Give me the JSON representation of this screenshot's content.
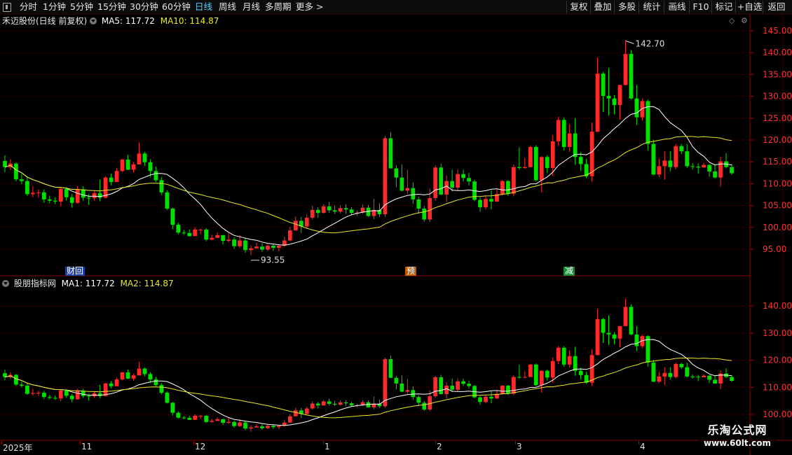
{
  "toolbar": {
    "periods": [
      "分时",
      "1分钟",
      "5分钟",
      "15分钟",
      "30分钟",
      "60分钟",
      "日线",
      "周线",
      "月线",
      "多周期",
      "更多 >"
    ],
    "active_period": "日线",
    "right_buttons": [
      "复权",
      "叠加",
      "多股",
      "统计",
      "画线",
      "F10",
      "标记",
      "+自选",
      "返回"
    ]
  },
  "main": {
    "stock_label": "禾迈股份(日线 前复权)",
    "ma5_label": "MA5: 117.72",
    "ma10_label": "MA10: 114.87",
    "high_annotation": "142.70",
    "low_annotation": "93.55",
    "price_axis": [
      "145.00",
      "140.00",
      "135.00",
      "130.00",
      "125.00",
      "120.00",
      "115.00",
      "110.00",
      "105.00",
      "100.00",
      "95.00"
    ],
    "events": [
      {
        "label": "财",
        "color": "#3b6fd8"
      },
      {
        "label": "回",
        "color": "#3b6fd8"
      },
      {
        "label": "预",
        "color": "#e07010"
      },
      {
        "label": "减",
        "color": "#22aa44"
      }
    ]
  },
  "sub": {
    "indicator_label": "股朋指标网",
    "ma1_label": "MA1: 117.72",
    "ma2_label": "MA2: 114.87",
    "price_axis": [
      "140.00",
      "130.00",
      "120.00",
      "110.00",
      "100.00"
    ]
  },
  "dates": [
    "2025年",
    "11",
    "12",
    "1",
    "2",
    "3",
    "4"
  ],
  "watermark": {
    "line1": "乐淘公式网",
    "line2": "www.60lt.com"
  },
  "colors": {
    "up": "#ff2b2b",
    "down": "#00e000",
    "ma_short": "#ffffff",
    "ma_long": "#e8e830",
    "grid": "#5a0000",
    "axis_text": "#ff3333"
  },
  "chart_data": {
    "type": "candlestick",
    "title": "禾迈股份(日线 前复权)",
    "ylim": [
      90,
      147
    ],
    "annotations": {
      "max": 142.7,
      "min": 93.55
    },
    "candles": [
      [
        115.2,
        113.8,
        116.5,
        112.6
      ],
      [
        113.8,
        114.6,
        115.6,
        113.1
      ],
      [
        114.6,
        111.0,
        114.9,
        110.5
      ],
      [
        111.0,
        110.6,
        112.2,
        109.9
      ],
      [
        110.6,
        107.6,
        111.4,
        107.2
      ],
      [
        107.6,
        107.9,
        109.4,
        106.9
      ],
      [
        107.9,
        108.0,
        108.7,
        106.8
      ],
      [
        108.0,
        106.4,
        108.7,
        105.6
      ],
      [
        106.4,
        106.1,
        107.2,
        105.5
      ],
      [
        106.1,
        105.9,
        106.9,
        105.3
      ],
      [
        105.9,
        108.8,
        109.2,
        104.9
      ],
      [
        108.8,
        106.9,
        109.2,
        106.1
      ],
      [
        106.9,
        105.6,
        107.6,
        104.5
      ],
      [
        105.6,
        108.7,
        109.4,
        105.4
      ],
      [
        108.7,
        106.8,
        109.4,
        106.1
      ],
      [
        106.8,
        106.7,
        107.6,
        105.1
      ],
      [
        106.7,
        107.8,
        108.5,
        106.1
      ],
      [
        107.8,
        106.8,
        110.9,
        106.0
      ],
      [
        106.8,
        111.4,
        111.7,
        106.6
      ],
      [
        111.4,
        110.4,
        112.3,
        109.6
      ],
      [
        110.4,
        112.9,
        113.5,
        110.4
      ],
      [
        112.9,
        115.5,
        115.7,
        112.7
      ],
      [
        115.5,
        113.2,
        116.6,
        113.1
      ],
      [
        113.2,
        114.4,
        115.0,
        112.5
      ],
      [
        114.4,
        116.9,
        119.4,
        114.4
      ],
      [
        116.9,
        114.9,
        117.3,
        114.1
      ],
      [
        114.9,
        112.9,
        115.6,
        111.5
      ],
      [
        112.9,
        110.8,
        113.9,
        110.4
      ],
      [
        110.8,
        108.0,
        111.5,
        107.4
      ],
      [
        108.0,
        104.3,
        108.5,
        104.0
      ],
      [
        104.3,
        100.6,
        104.5,
        99.6
      ],
      [
        100.6,
        98.8,
        101.1,
        98.4
      ],
      [
        98.8,
        98.7,
        99.4,
        98.3
      ],
      [
        98.7,
        98.0,
        99.5,
        97.9
      ],
      [
        98.0,
        99.5,
        100.0,
        98.0
      ],
      [
        99.5,
        99.5,
        99.7,
        98.4
      ],
      [
        99.5,
        97.2,
        99.8,
        96.8
      ],
      [
        97.2,
        97.6,
        98.3,
        97.0
      ],
      [
        97.6,
        98.2,
        98.9,
        97.6
      ],
      [
        98.2,
        96.9,
        98.3,
        96.1
      ],
      [
        96.9,
        97.2,
        98.7,
        96.6
      ],
      [
        97.2,
        95.7,
        97.7,
        95.1
      ],
      [
        95.7,
        97.0,
        98.2,
        95.3
      ],
      [
        97.0,
        94.8,
        97.5,
        94.2
      ],
      [
        94.8,
        95.2,
        95.9,
        93.6
      ],
      [
        95.2,
        95.6,
        96.5,
        95.1
      ],
      [
        95.6,
        94.9,
        96.4,
        94.4
      ],
      [
        94.9,
        95.8,
        96.1,
        94.6
      ],
      [
        95.8,
        95.3,
        96.3,
        94.6
      ],
      [
        95.3,
        95.8,
        96.1,
        94.5
      ],
      [
        95.8,
        97.0,
        97.9,
        95.5
      ],
      [
        97.0,
        99.3,
        100.1,
        96.8
      ],
      [
        99.3,
        101.5,
        102.5,
        99.3
      ],
      [
        101.5,
        100.2,
        102.4,
        98.7
      ],
      [
        100.2,
        102.2,
        102.9,
        99.7
      ],
      [
        102.2,
        104.0,
        104.9,
        101.8
      ],
      [
        104.0,
        103.3,
        104.6,
        102.2
      ],
      [
        103.3,
        104.8,
        105.3,
        103.2
      ],
      [
        104.8,
        103.9,
        105.8,
        103.3
      ],
      [
        103.9,
        103.6,
        105.0,
        103.1
      ],
      [
        103.6,
        104.4,
        105.1,
        103.2
      ],
      [
        104.4,
        104.1,
        105.3,
        103.1
      ],
      [
        104.1,
        103.3,
        104.6,
        102.8
      ],
      [
        103.3,
        103.4,
        103.9,
        102.6
      ],
      [
        103.4,
        104.5,
        105.3,
        103.1
      ],
      [
        104.5,
        102.6,
        105.1,
        102.4
      ],
      [
        102.6,
        104.0,
        106.6,
        101.9
      ],
      [
        104.0,
        103.0,
        105.5,
        102.4
      ],
      [
        103.0,
        120.4,
        120.9,
        102.4
      ],
      [
        120.4,
        113.5,
        121.8,
        113.5
      ],
      [
        113.5,
        111.4,
        114.2,
        109.2
      ],
      [
        111.4,
        108.4,
        114.4,
        108.2
      ],
      [
        108.4,
        109.0,
        113.2,
        107.6
      ],
      [
        109.0,
        106.4,
        110.3,
        105.4
      ],
      [
        106.4,
        104.3,
        107.0,
        103.1
      ],
      [
        104.3,
        101.8,
        104.9,
        101.3
      ],
      [
        101.8,
        106.7,
        108.9,
        101.2
      ],
      [
        106.7,
        113.7,
        114.2,
        106.1
      ],
      [
        113.7,
        107.5,
        114.6,
        107.4
      ],
      [
        107.5,
        110.6,
        111.8,
        105.8
      ],
      [
        110.6,
        109.1,
        113.2,
        108.2
      ],
      [
        109.1,
        112.2,
        113.3,
        108.5
      ],
      [
        112.2,
        111.3,
        113.2,
        110.5
      ],
      [
        111.3,
        110.5,
        112.5,
        109.6
      ],
      [
        110.5,
        106.3,
        110.9,
        106.0
      ],
      [
        106.3,
        104.6,
        106.9,
        103.6
      ],
      [
        104.6,
        106.5,
        107.1,
        104.1
      ],
      [
        106.5,
        105.9,
        108.5,
        104.1
      ],
      [
        105.9,
        107.6,
        108.9,
        105.8
      ],
      [
        107.6,
        110.6,
        110.8,
        107.3
      ],
      [
        110.6,
        107.7,
        110.8,
        107.2
      ],
      [
        107.7,
        113.8,
        114.4,
        107.1
      ],
      [
        113.8,
        113.6,
        118.3,
        113.2
      ],
      [
        113.6,
        113.8,
        115.9,
        113.4
      ],
      [
        113.8,
        118.4,
        118.7,
        113.8
      ],
      [
        118.4,
        110.8,
        118.8,
        110.5
      ],
      [
        110.8,
        116.1,
        116.3,
        108.0
      ],
      [
        116.1,
        113.6,
        116.5,
        112.5
      ],
      [
        113.6,
        119.7,
        121.1,
        111.7
      ],
      [
        119.7,
        124.6,
        125.3,
        118.6
      ],
      [
        124.6,
        118.4,
        125.2,
        117.6
      ],
      [
        118.4,
        121.5,
        123.6,
        117.3
      ],
      [
        121.5,
        116.1,
        125.0,
        114.3
      ],
      [
        116.1,
        114.5,
        117.2,
        112.9
      ],
      [
        114.5,
        111.7,
        115.7,
        111.3
      ],
      [
        111.7,
        121.9,
        124.0,
        110.5
      ],
      [
        121.9,
        135.2,
        138.9,
        121.8
      ],
      [
        135.2,
        130.1,
        135.6,
        126.4
      ],
      [
        130.1,
        129.5,
        136.5,
        125.6
      ],
      [
        129.5,
        128.0,
        130.3,
        125.9
      ],
      [
        128.0,
        132.6,
        132.6,
        124.7
      ],
      [
        132.6,
        139.7,
        142.7,
        132.5
      ],
      [
        139.7,
        129.5,
        140.6,
        129.3
      ],
      [
        129.5,
        125.2,
        132.6,
        123.4
      ],
      [
        125.2,
        128.9,
        129.4,
        124.4
      ],
      [
        128.9,
        119.1,
        129.2,
        117.6
      ],
      [
        119.1,
        112.1,
        120.1,
        111.9
      ],
      [
        112.1,
        114.0,
        115.7,
        111.5
      ],
      [
        114.0,
        115.3,
        117.4,
        110.9
      ],
      [
        115.3,
        113.8,
        117.4,
        112.8
      ],
      [
        113.8,
        118.6,
        119.1,
        113.3
      ],
      [
        118.6,
        117.4,
        119.1,
        116.8
      ],
      [
        117.4,
        114.0,
        119.1,
        113.6
      ],
      [
        114.0,
        113.9,
        114.7,
        113.2
      ],
      [
        113.9,
        113.7,
        114.6,
        112.3
      ],
      [
        113.7,
        114.3,
        114.8,
        113.7
      ],
      [
        114.3,
        112.8,
        114.5,
        111.6
      ],
      [
        112.8,
        111.4,
        114.5,
        111.2
      ],
      [
        111.4,
        115.1,
        116.2,
        109.3
      ],
      [
        115.1,
        113.8,
        117.0,
        113.5
      ],
      [
        113.8,
        112.4,
        114.5,
        112.0
      ]
    ],
    "sub_ylim": [
      98,
      148
    ]
  }
}
